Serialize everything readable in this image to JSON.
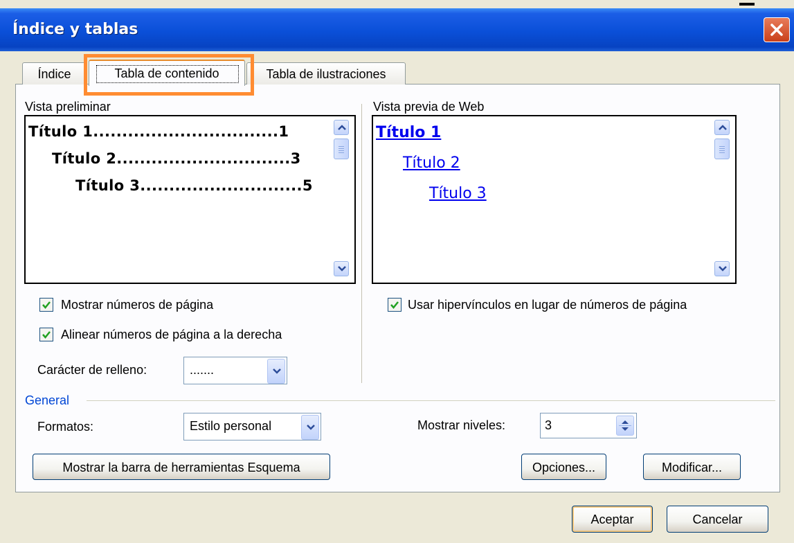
{
  "window": {
    "title": "Índice y tablas"
  },
  "tabs": [
    {
      "label": "Índice",
      "active": false
    },
    {
      "label": "Tabla de contenido",
      "active": true
    },
    {
      "label": "Tabla de ilustraciones",
      "active": false
    }
  ],
  "print_preview": {
    "label": "Vista preliminar",
    "lines": [
      {
        "text": "Título 1",
        "leader": "................................",
        "page": "1"
      },
      {
        "text": "Título 2",
        "leader": "..............................",
        "page": "3"
      },
      {
        "text": "Título 3",
        "leader": "............................",
        "page": "5"
      }
    ]
  },
  "web_preview": {
    "label": "Vista previa de Web",
    "links": [
      "Título 1",
      "Título 2",
      "Título 3"
    ]
  },
  "options": {
    "show_page_numbers": {
      "label": "Mostrar números de página",
      "checked": true
    },
    "align_right": {
      "label": "Alinear números de página a la derecha",
      "checked": true
    },
    "use_hyperlinks": {
      "label": "Usar hipervínculos en lugar de números de página",
      "checked": true
    },
    "tab_leader": {
      "label": "Carácter de relleno:",
      "value": "......."
    }
  },
  "general": {
    "legend": "General",
    "formats": {
      "label": "Formatos:",
      "value": "Estilo personal"
    },
    "show_levels": {
      "label": "Mostrar niveles:",
      "value": "3"
    }
  },
  "buttons": {
    "outline_toolbar": "Mostrar la barra de herramientas Esquema",
    "options": "Opciones...",
    "modify": "Modificar...",
    "ok": "Aceptar",
    "cancel": "Cancelar"
  },
  "colors": {
    "titlebar": "#0a4fd8",
    "highlight": "#ff8c32",
    "link": "#0000ee",
    "check": "#21a121"
  }
}
